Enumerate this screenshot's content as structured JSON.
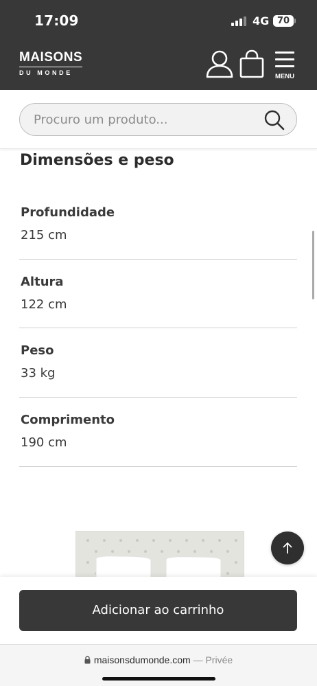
{
  "status_bar": {
    "time": "17:09",
    "network": "4G",
    "battery": "70"
  },
  "header": {
    "logo_main": "MAISONS",
    "logo_sub": "DU MONDE",
    "menu_label": "MENU"
  },
  "search": {
    "placeholder": "Procuro um produto..."
  },
  "section": {
    "title": "Dimensões e peso"
  },
  "dimensions": [
    {
      "label": "Profundidade",
      "value": "215 cm"
    },
    {
      "label": "Altura",
      "value": "122 cm"
    },
    {
      "label": "Peso",
      "value": "33 kg"
    },
    {
      "label": "Comprimento",
      "value": "190 cm"
    }
  ],
  "cart": {
    "button_label": "Adicionar ao carrinho"
  },
  "browser": {
    "url": "maisonsdumonde.com",
    "separator": " — ",
    "privacy": "Privée"
  },
  "colors": {
    "header_bg": "#383838",
    "button_bg": "#383838"
  }
}
